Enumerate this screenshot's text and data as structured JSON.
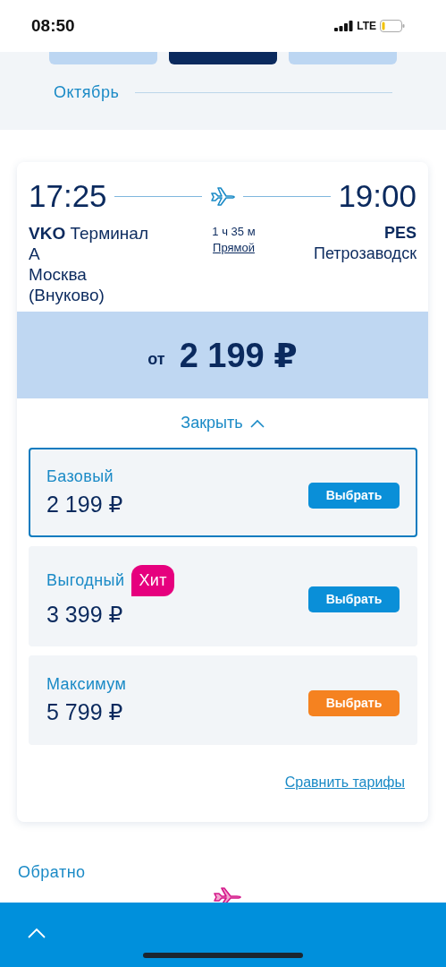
{
  "status_bar": {
    "time": "08:50",
    "network": "LTE"
  },
  "date_tabs": [
    {
      "selected": false
    },
    {
      "selected": true
    },
    {
      "selected": false
    }
  ],
  "month": "Октябрь",
  "flight": {
    "departure_time": "17:25",
    "arrival_time": "19:00",
    "origin": {
      "code": "VKO",
      "terminal": "Терминал А",
      "city": "Москва (Внуково)"
    },
    "duration": "1 ч 35 м",
    "flight_type": "Прямой",
    "destination": {
      "code": "PES",
      "city": "Петрозаводск"
    },
    "price_prefix": "от",
    "price": "2 199 ₽",
    "collapse_label": "Закрыть",
    "fares": [
      {
        "name": "Базовый",
        "price": "2 199 ₽",
        "selected": true,
        "button": {
          "label": "Выбрать",
          "kind": "primary"
        }
      },
      {
        "name": "Выгодный",
        "badge": "Хит",
        "price": "3 399 ₽",
        "selected": false,
        "button": {
          "label": "Выбрать",
          "kind": "primary"
        }
      },
      {
        "name": "Максимум",
        "price": "5 799 ₽",
        "selected": false,
        "button": {
          "label": "Выбрать",
          "kind": "accent"
        }
      }
    ],
    "compare_link": "Сравнить тарифы"
  },
  "return_section": {
    "title": "Обратно"
  }
}
